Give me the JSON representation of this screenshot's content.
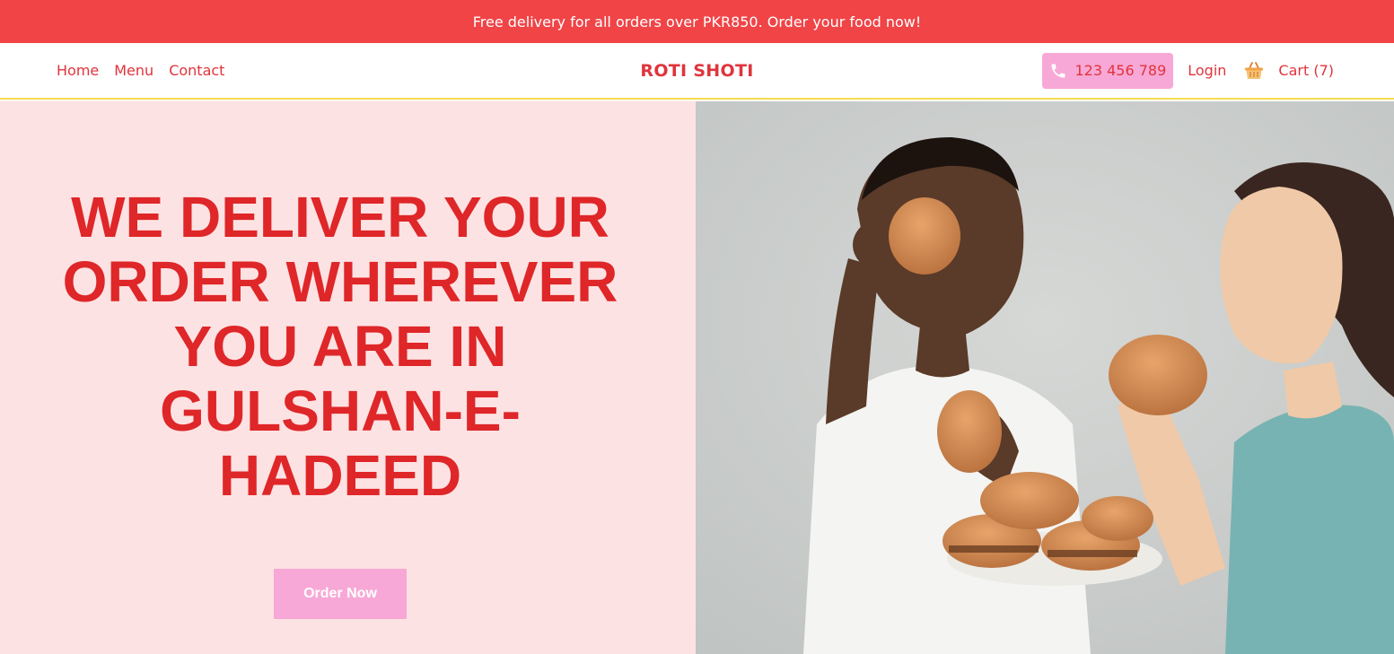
{
  "announcement": {
    "text": "Free delivery for all orders over PKR850. Order your food now!"
  },
  "nav": {
    "links": [
      "Home",
      "Menu",
      "Contact"
    ],
    "brand": "ROTI SHOTI",
    "phone": "123 456 789",
    "login": "Login",
    "cart": "Cart (7)"
  },
  "hero": {
    "headline_lines": [
      "WE DELIVER YOUR",
      "ORDER WHEREVER",
      "YOU ARE IN",
      "GULSHAN-E-",
      "HADEED"
    ],
    "cta": "Order Now"
  },
  "colors": {
    "accent_red": "#f04447",
    "text_red": "#e0343c",
    "pink_button": "#f7a8d6",
    "hero_bg": "#fde2e3",
    "nav_border_yellow": "#f7dc4e"
  },
  "icons": [
    "phone-icon",
    "cart-basket-icon"
  ]
}
